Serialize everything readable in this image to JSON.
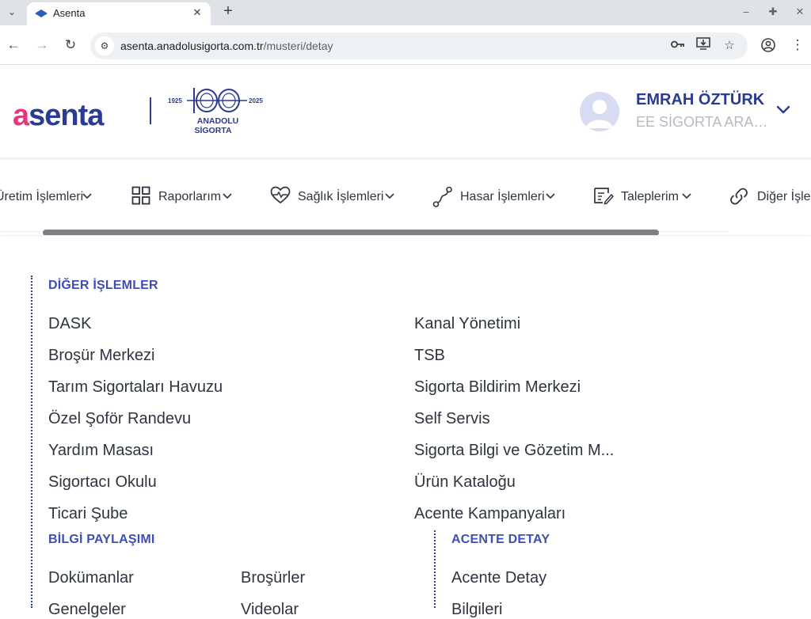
{
  "browser": {
    "tab_title": "Asenta",
    "url_domain": "asenta.anadolusigorta.com.tr",
    "url_path": "/musteri/detay"
  },
  "header": {
    "logo_text": "asenta",
    "centennial": {
      "year_start": "1925",
      "year_end": "2025",
      "brand_line1": "ANADOLU",
      "brand_line2": "SİGORTA"
    },
    "user_name": "EMRAH ÖZTÜRK",
    "user_company": "EE SİGORTA ARACILIK HİZMETLERİ"
  },
  "menu": {
    "items": [
      {
        "label": "Üretim İşlemleri",
        "icon": "production-icon"
      },
      {
        "label": "Raporlarım",
        "icon": "grid-icon"
      },
      {
        "label": "Sağlık İşlemleri",
        "icon": "heart-pulse-icon"
      },
      {
        "label": "Hasar İşlemleri",
        "icon": "route-icon"
      },
      {
        "label": "Taleplerim",
        "icon": "edit-list-icon"
      },
      {
        "label": "Diğer İşlemler",
        "icon": "link-icon"
      }
    ]
  },
  "diger_islemler": {
    "title": "DİĞER İŞLEMLER",
    "left": [
      "DASK",
      "Broşür Merkezi",
      "Tarım Sigortaları Havuzu",
      "Özel Şoför Randevu",
      "Yardım Masası",
      "Sigortacı Okulu",
      "Ticari Şube"
    ],
    "right": [
      "Kanal Yönetimi",
      "TSB",
      "Sigorta Bildirim Merkezi",
      "Self Servis",
      "Sigorta Bilgi ve Gözetim M...",
      "Ürün Kataloğu",
      "Acente Kampanyaları"
    ]
  },
  "bilgi_paylasimi": {
    "title": "BİLGİ PAYLAŞIMI",
    "col1": [
      "Dokümanlar",
      "Genelgeler"
    ],
    "col2": [
      "Broşürler",
      "Videolar"
    ]
  },
  "acente_detay": {
    "title": "ACENTE DETAY",
    "items": [
      "Acente Detay",
      "Bilgileri"
    ]
  },
  "colors": {
    "brand_blue": "#2b3a93",
    "brand_pink": "#e7357b",
    "section_title": "#3f4db6"
  }
}
